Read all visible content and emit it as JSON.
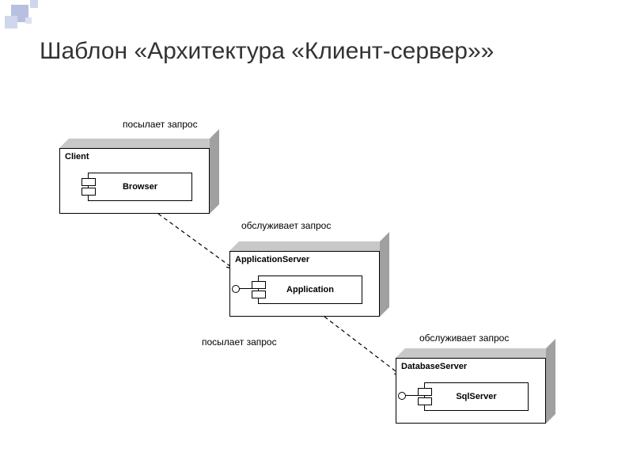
{
  "slide": {
    "title": "Шаблон «Архитектура «Клиент-сервер»»"
  },
  "captions": {
    "sends1": "посылает запрос",
    "serves1": "обслуживает запрос",
    "sends2": "посылает запрос",
    "serves2": "обслуживает запрос"
  },
  "nodes": {
    "client": {
      "title": "Client",
      "component": "Browser"
    },
    "appserver": {
      "title": "ApplicationServer",
      "component": "Application"
    },
    "dbserver": {
      "title": "DatabaseServer",
      "component": "SqlServer"
    }
  }
}
